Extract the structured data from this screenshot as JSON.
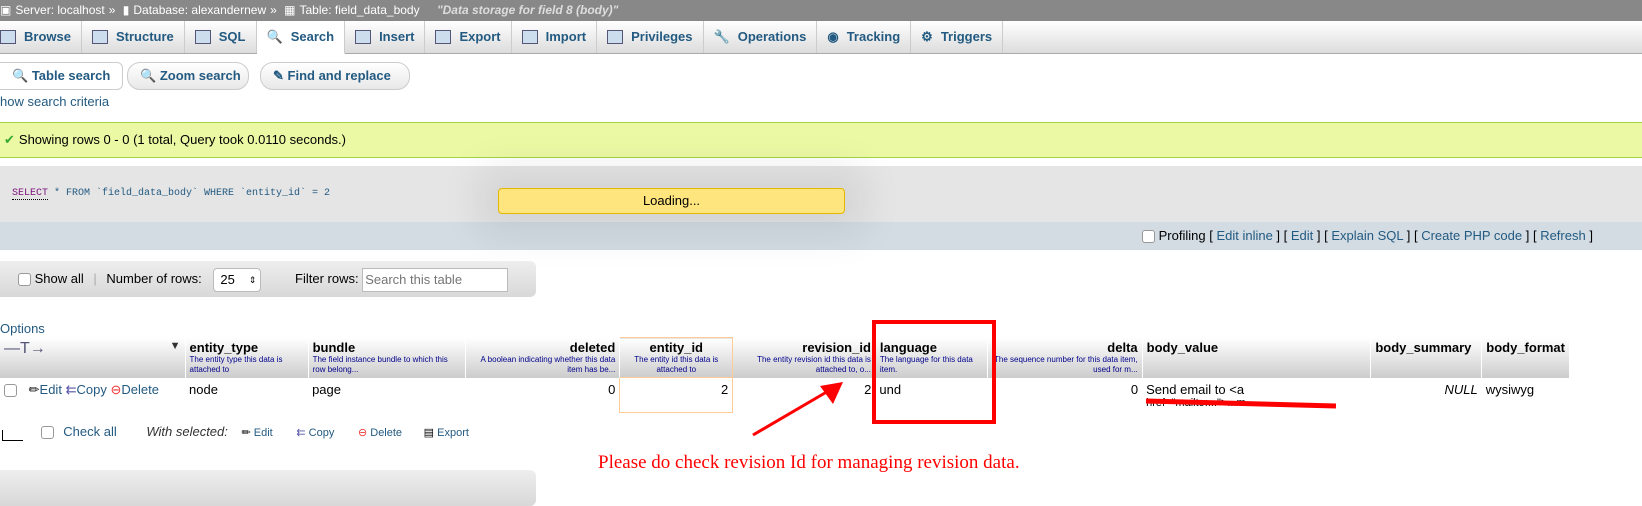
{
  "breadcrumb": {
    "server": "Server: localhost",
    "database": "Database: alexandernew",
    "table": "Table: field_data_body",
    "comment": "\"Data storage for field 8 (body)\""
  },
  "tabs": [
    "Browse",
    "Structure",
    "SQL",
    "Search",
    "Insert",
    "Export",
    "Import",
    "Privileges",
    "Operations",
    "Tracking",
    "Triggers"
  ],
  "active_tab": "Search",
  "subtabs": [
    "Table search",
    "Zoom search",
    "Find and replace"
  ],
  "show_criteria": "how search criteria",
  "success": "Showing rows 0 - 0 (1 total, Query took 0.0110 seconds.)",
  "sql": {
    "select": "SELECT",
    "rest": " * FROM `field_data_body` WHERE `entity_id` = 2"
  },
  "loading": "Loading...",
  "tools": {
    "profiling": "Profiling",
    "links": [
      "Edit inline",
      "Edit",
      "Explain SQL",
      "Create PHP code",
      "Refresh"
    ]
  },
  "nav": {
    "show_all": "Show all",
    "rows_label": "Number of rows:",
    "rows_value": "25",
    "filter_label": "Filter rows:",
    "filter_placeholder": "Search this table"
  },
  "options": "Options",
  "columns": [
    {
      "name": "entity_type",
      "desc": "The entity type this data is attached to"
    },
    {
      "name": "bundle",
      "desc": "The field instance bundle to which this row belong..."
    },
    {
      "name": "deleted",
      "desc": "A boolean indicating whether this data item has be..."
    },
    {
      "name": "entity_id",
      "desc": "The entity id this data is attached to"
    },
    {
      "name": "revision_id",
      "desc": "The entity revision id this data is attached to, o..."
    },
    {
      "name": "language",
      "desc": "The language for this data item."
    },
    {
      "name": "delta",
      "desc": "The sequence number for this data item, used for m..."
    },
    {
      "name": "body_value",
      "desc": ""
    },
    {
      "name": "body_summary",
      "desc": ""
    },
    {
      "name": "body_format",
      "desc": ""
    }
  ],
  "row": {
    "actions": [
      "Edit",
      "Copy",
      "Delete"
    ],
    "values": [
      "node",
      "page",
      "0",
      "2",
      "2",
      "und",
      "0",
      "Send email to <a",
      "NULL",
      "wysiwyg"
    ],
    "body_value_line2": "href=\"mailto:...\">...m..."
  },
  "bulk": {
    "check_all": "Check all",
    "with_selected": "With selected:",
    "actions": [
      "Edit",
      "Copy",
      "Delete",
      "Export"
    ]
  },
  "annotation": "Please do check revision Id for managing revision data.",
  "colors": {
    "annotation": "#ff0000",
    "success_bg": "#ebf8a4",
    "loading_bg": "#ffe57e",
    "link": "#235a81"
  }
}
